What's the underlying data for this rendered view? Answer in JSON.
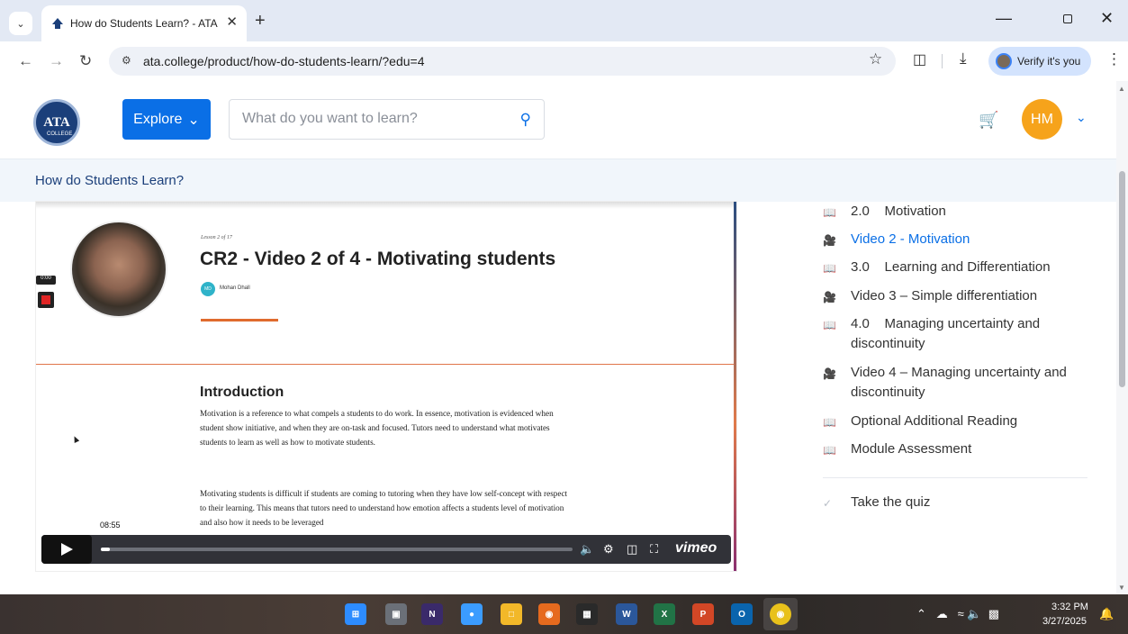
{
  "browser": {
    "tab_title": "How do Students Learn? - ATA",
    "url": "ata.college/product/how-do-students-learn/?edu=4",
    "verify_label": "Verify it's you"
  },
  "header": {
    "logo_text": "ATA",
    "logo_sub": "COLLEGE",
    "explore_label": "Explore",
    "search_placeholder": "What do you want to learn?",
    "user_initials": "HM",
    "colors": {
      "brand_blue": "#0a6fe6",
      "avatar_orange": "#f6a31b",
      "navy": "#1b3f7a"
    }
  },
  "course": {
    "title": "How do Students Learn?"
  },
  "video": {
    "recording_time": "0:00",
    "lesson_count": "Lesson 2 of 17",
    "lesson_title": "CR2 - Video 2 of 4 - Motivating students",
    "author_initials": "MD",
    "author_name": "Mohan Dhall",
    "intro_heading": "Introduction",
    "intro_p1": "Motivation is a reference to what compels a students to do work. In essence, motivation is evidenced when student show initiative, and when they are on-task and focused. Tutors need to understand what motivates students to learn as well as how to motivate students.",
    "intro_p2": "Motivating students is difficult if students are coming to tutoring when they have low self-concept with respect to their learning. This means that tutors need to understand how emotion affects a students level of motivation and also how it needs to be leveraged",
    "player_time": "08:55",
    "progress_fraction": 0.02,
    "vimeo_label": "vimeo"
  },
  "sidebar": {
    "items": [
      {
        "num": "2.0",
        "label": "Motivation",
        "icon": "book-icon",
        "active": false
      },
      {
        "num": "",
        "label": "Video 2 - Motivation",
        "icon": "video-icon",
        "active": true
      },
      {
        "num": "3.0",
        "label": "Learning and Differentiation",
        "icon": "book-icon",
        "active": false
      },
      {
        "num": "",
        "label": "Video 3 – Simple differentiation",
        "icon": "video-icon",
        "active": false
      },
      {
        "num": "4.0",
        "label": "Managing uncertainty and discontinuity",
        "icon": "book-icon",
        "active": false
      },
      {
        "num": "",
        "label": "Video 4 – Managing uncertainty and discontinuity",
        "icon": "video-icon",
        "active": false
      },
      {
        "num": "",
        "label": "Optional Additional Reading",
        "icon": "book-icon",
        "active": false
      },
      {
        "num": "",
        "label": "Module Assessment",
        "icon": "book-icon",
        "active": false
      }
    ],
    "quiz_label": "Take the quiz"
  },
  "taskbar": {
    "time": "3:32 PM",
    "date": "3/27/2025"
  }
}
